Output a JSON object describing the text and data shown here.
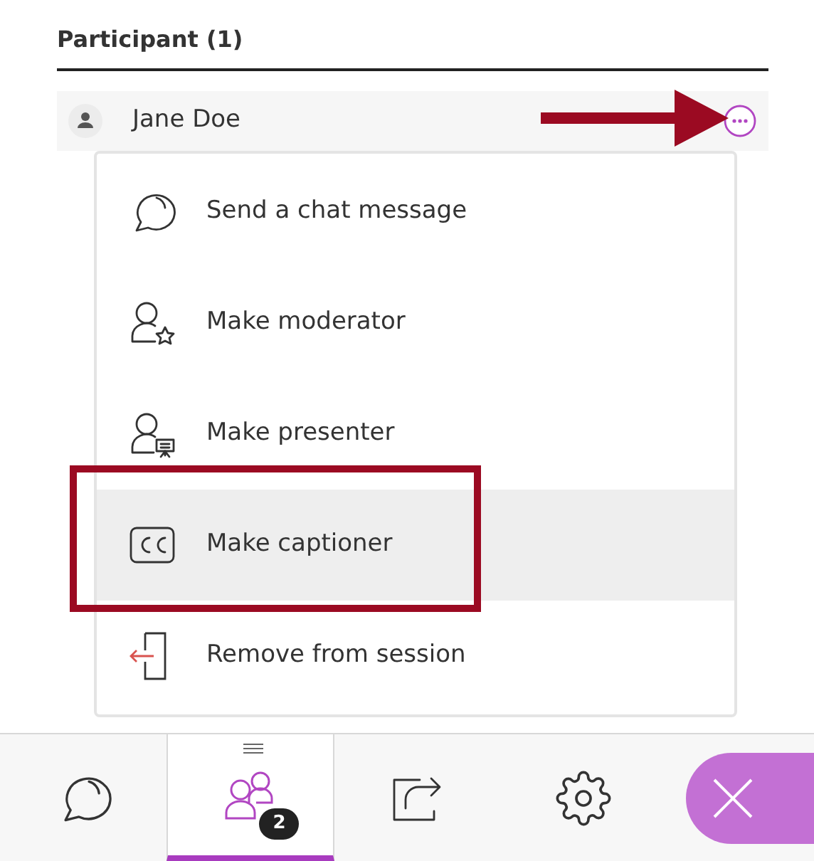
{
  "panel": {
    "title": "Participant (1)"
  },
  "participant": {
    "name": "Jane Doe"
  },
  "menu": [
    {
      "kind": "chat",
      "label": "Send a chat message",
      "highlighted": false
    },
    {
      "kind": "moderator",
      "label": "Make moderator",
      "highlighted": false
    },
    {
      "kind": "presenter",
      "label": "Make presenter",
      "highlighted": false
    },
    {
      "kind": "captioner",
      "label": "Make captioner",
      "highlighted": true
    },
    {
      "kind": "remove",
      "label": "Remove from session",
      "highlighted": false
    }
  ],
  "tabs": [
    {
      "kind": "chat",
      "selected": false
    },
    {
      "kind": "participants",
      "selected": true,
      "badge": "2"
    },
    {
      "kind": "share",
      "selected": false
    },
    {
      "kind": "settings",
      "selected": false
    }
  ]
}
